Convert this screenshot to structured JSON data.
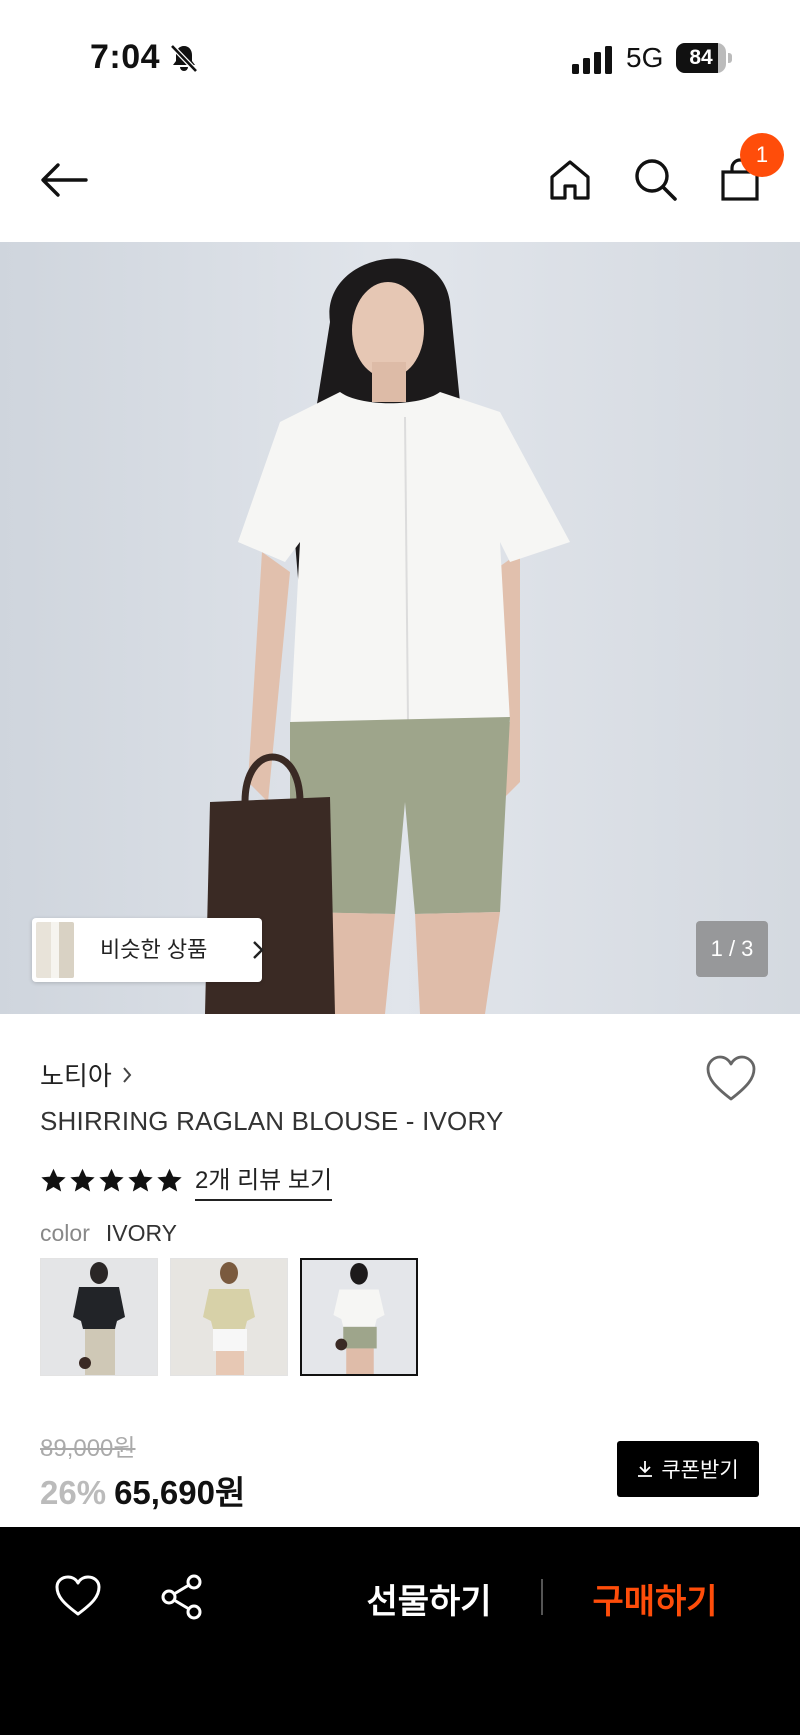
{
  "status_bar": {
    "time": "7:04",
    "network": "5G",
    "battery_level": "84",
    "battery_fraction": 0.84,
    "icons": [
      "bell-slash-icon",
      "signal-icon"
    ]
  },
  "header": {
    "icons": [
      "back-arrow-icon",
      "home-icon",
      "search-icon",
      "shopping-bag-icon"
    ],
    "cart_count": "1",
    "badge_color": "#ff4d0a"
  },
  "gallery": {
    "similar_label": "비슷한 상품",
    "counter": "1 / 3"
  },
  "product": {
    "brand": "노티아",
    "title": "SHIRRING RAGLAN BLOUSE - IVORY",
    "rating": 5,
    "review_link": "2개 리뷰 보기",
    "color_label": "color",
    "color_value": "IVORY",
    "color_options": [
      "BLACK",
      "BEIGE",
      "IVORY"
    ],
    "selected_color_index": 2
  },
  "price": {
    "original": "89,000원",
    "discount": "26%",
    "sale": "65,690원",
    "coupon_label": "쿠폰받기"
  },
  "bottom_bar": {
    "gift_label": "선물하기",
    "buy_label": "구매하기",
    "accent_color": "#ff4d0a",
    "icons": [
      "heart-outline-icon",
      "share-icon"
    ]
  }
}
